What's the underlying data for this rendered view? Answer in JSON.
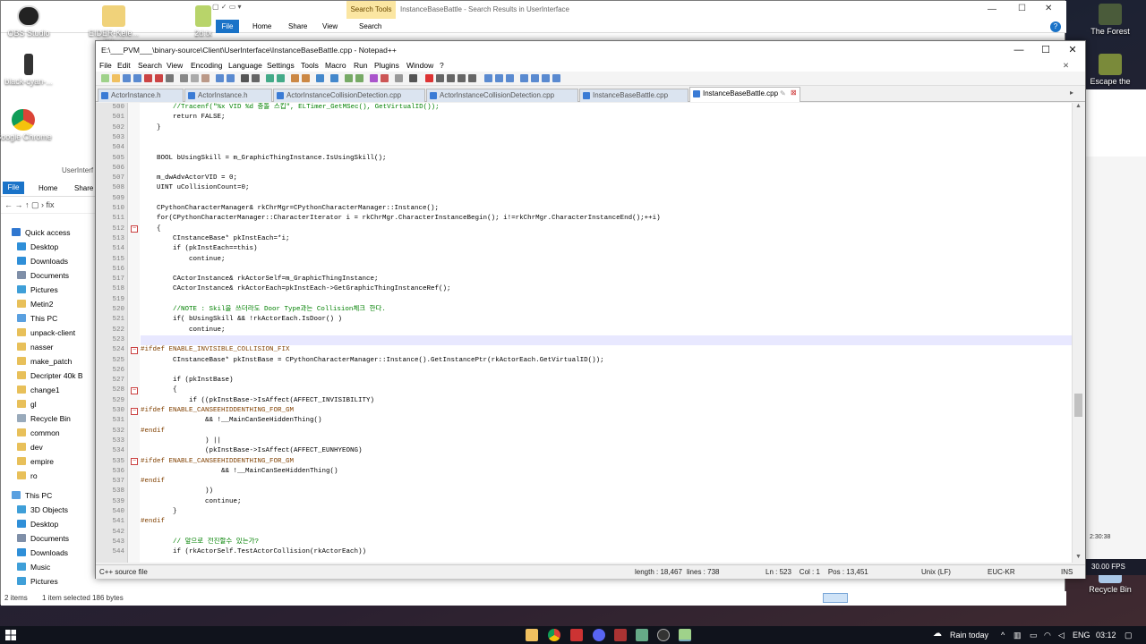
{
  "desktop": {
    "icons_left": [
      {
        "label": "OBS Studio",
        "color": "#2b2b2b"
      },
      {
        "label": "black-cyan-...",
        "color": "#444"
      },
      {
        "label": "Google Chrome",
        "color": "#e0342b"
      }
    ],
    "icons_mid": [
      {
        "label": "EIDER-Kele... Effect",
        "color": "#f0d27a"
      },
      {
        "label": "2d.tx",
        "color": "#b8d46a"
      }
    ],
    "icons_right": [
      {
        "label": "The Forest",
        "color": "#4a5b3a"
      },
      {
        "label": "Escape the",
        "color": "#7a8a3a"
      },
      {
        "label": "Recycle Bin",
        "color": "#aac8e8"
      }
    ],
    "fps_label": "30.00 FPS",
    "clock_behind": "2:30:38"
  },
  "explorer": {
    "title": "InstanceBaseBattle - Search Results in UserInterface",
    "search_tools": "Search Tools",
    "tabs": [
      "File",
      "Home",
      "Share",
      "View",
      "Search"
    ],
    "nav_path": "UserInterf",
    "quick_access": "Quick access",
    "left_items": [
      "Desktop",
      "Downloads",
      "Documents",
      "Pictures",
      "Metin2",
      "This PC",
      "unpack-client",
      "nasser",
      "make_patch",
      "Decripter 40k B",
      "change1",
      "gl",
      "Recycle Bin",
      "common",
      "dev",
      "empire",
      "ro"
    ],
    "this_pc": "This PC",
    "pc_items": [
      "3D Objects",
      "Desktop",
      "Documents",
      "Downloads",
      "Music",
      "Pictures"
    ],
    "status_items": "2 items",
    "status_selected": "1 item selected 186 bytes"
  },
  "npp": {
    "title": "E:\\___PVM___\\binary-source\\Client\\UserInterface\\InstanceBaseBattle.cpp - Notepad++",
    "menu": [
      "File",
      "Edit",
      "Search",
      "View",
      "Encoding",
      "Language",
      "Settings",
      "Tools",
      "Macro",
      "Run",
      "Plugins",
      "Window",
      "?"
    ],
    "tabs": [
      {
        "label": "ActorInstance.h",
        "active": false
      },
      {
        "label": "ActorInstance.h",
        "active": false
      },
      {
        "label": "ActorInstanceCollisionDetection.cpp",
        "active": false
      },
      {
        "label": "ActorInstanceCollisionDetection.cpp",
        "active": false
      },
      {
        "label": "InstanceBaseBattle.cpp",
        "active": false
      },
      {
        "label": "InstanceBaseBattle.cpp",
        "active": true
      }
    ],
    "lines": [
      {
        "n": "500",
        "t": "        //Tracenf(\"%x VID %d 충돌 스킵\", ELTimer_GetMSec(), GetVirtualID());",
        "c": "cm"
      },
      {
        "n": "501",
        "t": "        return FALSE;",
        "c": ""
      },
      {
        "n": "502",
        "t": "    }",
        "c": ""
      },
      {
        "n": "503",
        "t": "",
        "c": ""
      },
      {
        "n": "504",
        "t": "",
        "c": ""
      },
      {
        "n": "505",
        "t": "    BOOL bUsingSkill = m_GraphicThingInstance.IsUsingSkill();",
        "c": ""
      },
      {
        "n": "506",
        "t": "",
        "c": ""
      },
      {
        "n": "507",
        "t": "    m_dwAdvActorVID = 0;",
        "c": ""
      },
      {
        "n": "508",
        "t": "    UINT uCollisionCount=0;",
        "c": ""
      },
      {
        "n": "509",
        "t": "",
        "c": ""
      },
      {
        "n": "510",
        "t": "    CPythonCharacterManager& rkChrMgr=CPythonCharacterManager::Instance();",
        "c": ""
      },
      {
        "n": "511",
        "t": "    for(CPythonCharacterManager::CharacterIterator i = rkChrMgr.CharacterInstanceBegin(); i!=rkChrMgr.CharacterInstanceEnd();++i)",
        "c": ""
      },
      {
        "n": "512",
        "t": "    {",
        "c": ""
      },
      {
        "n": "513",
        "t": "        CInstanceBase* pkInstEach=*i;",
        "c": ""
      },
      {
        "n": "514",
        "t": "        if (pkInstEach==this)",
        "c": ""
      },
      {
        "n": "515",
        "t": "            continue;",
        "c": ""
      },
      {
        "n": "516",
        "t": "",
        "c": ""
      },
      {
        "n": "517",
        "t": "        CActorInstance& rkActorSelf=m_GraphicThingInstance;",
        "c": ""
      },
      {
        "n": "518",
        "t": "        CActorInstance& rkActorEach=pkInstEach->GetGraphicThingInstanceRef();",
        "c": ""
      },
      {
        "n": "519",
        "t": "",
        "c": ""
      },
      {
        "n": "520",
        "t": "        //NOTE : Skil을 쓰더라도 Door Type과는 Collision체크 한다.",
        "c": "cm"
      },
      {
        "n": "521",
        "t": "        if( bUsingSkill && !rkActorEach.IsDoor() )",
        "c": ""
      },
      {
        "n": "522",
        "t": "            continue;",
        "c": ""
      },
      {
        "n": "523",
        "t": "",
        "c": "cur"
      },
      {
        "n": "524",
        "t": "#ifdef ENABLE_INVISIBLE_COLLISION_FIX",
        "c": "pp"
      },
      {
        "n": "525",
        "t": "        CInstanceBase* pkInstBase = CPythonCharacterManager::Instance().GetInstancePtr(rkActorEach.GetVirtualID());",
        "c": ""
      },
      {
        "n": "526",
        "t": "",
        "c": ""
      },
      {
        "n": "527",
        "t": "        if (pkInstBase)",
        "c": ""
      },
      {
        "n": "528",
        "t": "        {",
        "c": ""
      },
      {
        "n": "529",
        "t": "            if ((pkInstBase->IsAffect(AFFECT_INVISIBILITY)",
        "c": ""
      },
      {
        "n": "530",
        "t": "#ifdef ENABLE_CANSEEHIDDENTHING_FOR_GM",
        "c": "pp"
      },
      {
        "n": "531",
        "t": "                && !__MainCanSeeHiddenThing()",
        "c": ""
      },
      {
        "n": "532",
        "t": "#endif",
        "c": "pp"
      },
      {
        "n": "533",
        "t": "                ) ||",
        "c": ""
      },
      {
        "n": "534",
        "t": "                (pkInstBase->IsAffect(AFFECT_EUNHYEONG)",
        "c": ""
      },
      {
        "n": "535",
        "t": "#ifdef ENABLE_CANSEEHIDDENTHING_FOR_GM",
        "c": "pp"
      },
      {
        "n": "536",
        "t": "                    && !__MainCanSeeHiddenThing()",
        "c": ""
      },
      {
        "n": "537",
        "t": "#endif",
        "c": "pp"
      },
      {
        "n": "538",
        "t": "                ))",
        "c": ""
      },
      {
        "n": "539",
        "t": "                continue;",
        "c": ""
      },
      {
        "n": "540",
        "t": "        }",
        "c": ""
      },
      {
        "n": "541",
        "t": "#endif",
        "c": "pp"
      },
      {
        "n": "542",
        "t": "",
        "c": ""
      },
      {
        "n": "543",
        "t": "        // 앞으로 전진할수 있는가?",
        "c": "cm"
      },
      {
        "n": "544",
        "t": "        if (rkActorSelf.TestActorCollision(rkActorEach))",
        "c": ""
      }
    ],
    "status": {
      "type": "C++ source file",
      "length": "length : 18,467",
      "lines": "lines : 738",
      "pos": "Ln : 523    Col : 1    Pos : 13,451",
      "eol": "Unix (LF)",
      "enc": "EUC-KR",
      "ins": "INS"
    }
  },
  "taskbar": {
    "weather": "Rain today",
    "lang": "ENG",
    "time": "03:12"
  }
}
